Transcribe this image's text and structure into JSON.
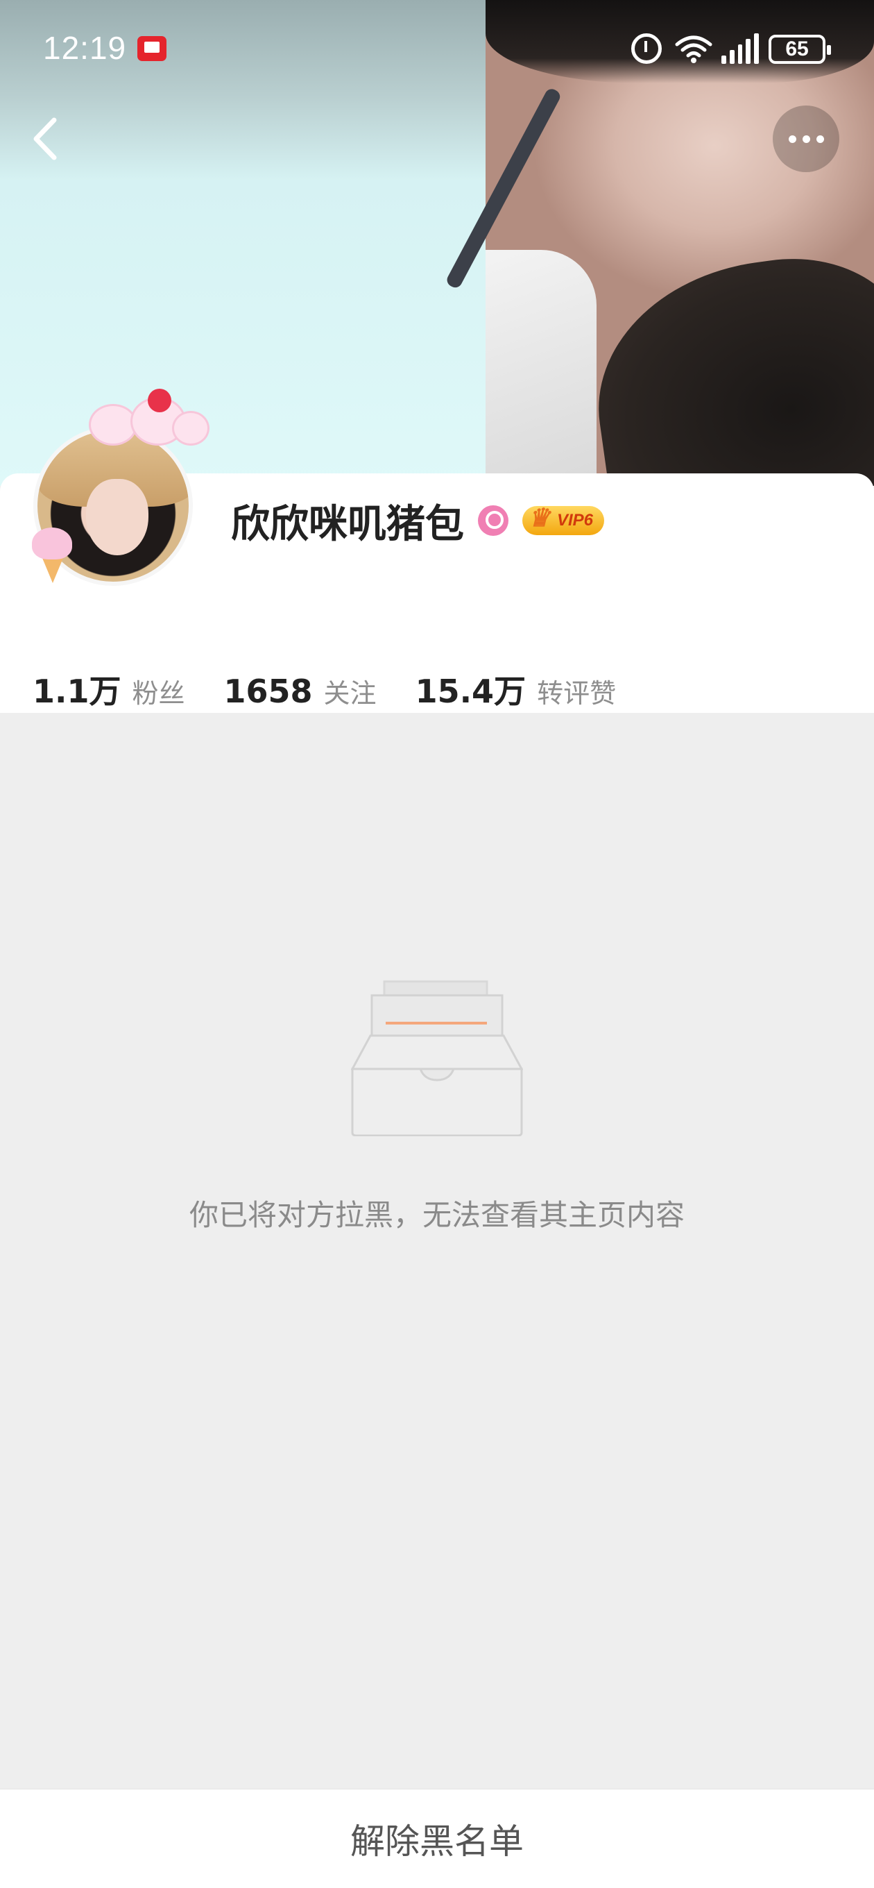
{
  "status_bar": {
    "time": "12:19",
    "battery": "65",
    "icons": [
      "app-notification-icon",
      "alarm-icon",
      "wifi-icon",
      "signal-icon",
      "battery-icon"
    ]
  },
  "header": {
    "back_icon": "chevron-left-icon",
    "more_icon": "more-dots-icon"
  },
  "profile": {
    "username": "欣欣咪叽猪包",
    "gender_icon": "female-icon",
    "vip_label": "VIP6",
    "stats": [
      {
        "value": "1.1万",
        "label": "粉丝"
      },
      {
        "value": "1658",
        "label": "关注"
      },
      {
        "value": "15.4万",
        "label": "转评赞"
      }
    ]
  },
  "empty_state": {
    "icon": "empty-box-icon",
    "message": "你已将对方拉黑，无法查看其主页内容"
  },
  "bottom_bar": {
    "unblock_label": "解除黑名单"
  },
  "colors": {
    "background": "#eeeeee",
    "card": "#ffffff",
    "text_primary": "#222222",
    "text_secondary": "#8e8e8e",
    "gender_pink": "#f07fb3",
    "vip_gold": "#f3a70f",
    "illustration_accent": "#f4a77c"
  }
}
